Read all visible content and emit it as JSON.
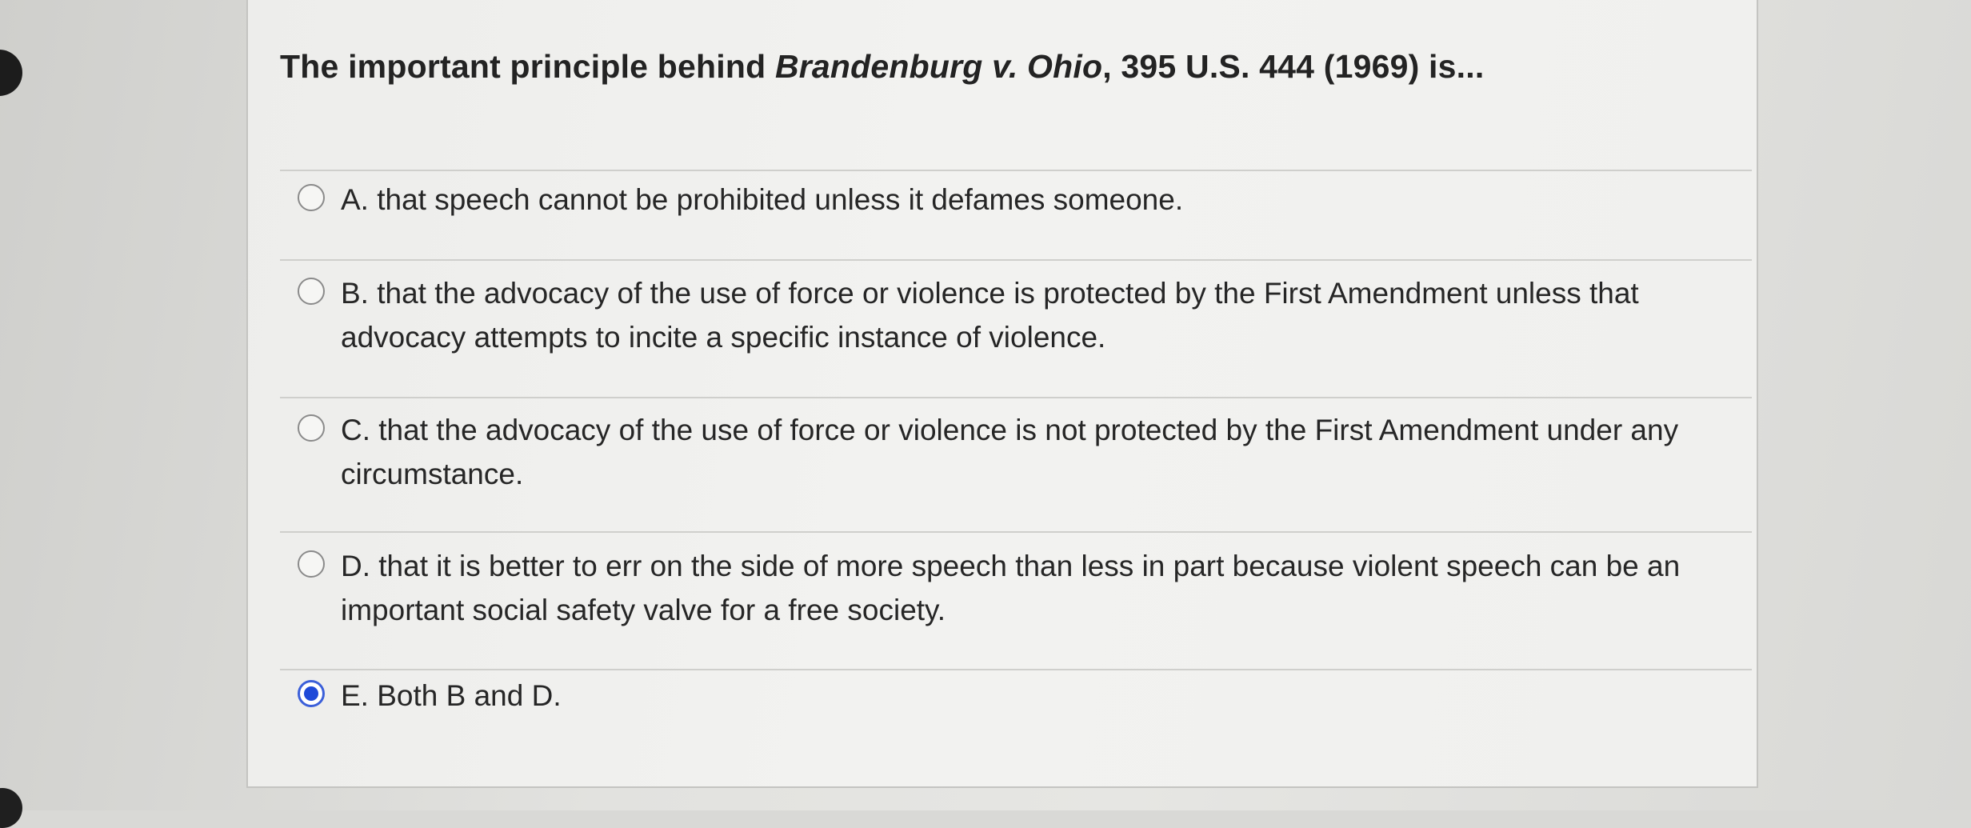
{
  "question": {
    "prefix": "The important principle behind ",
    "case_name": "Brandenburg v. Ohio",
    "suffix": ", 395 U.S. 444 (1969) is..."
  },
  "options": [
    {
      "label": "A. that speech cannot be prohibited unless it defames someone.",
      "selected": false
    },
    {
      "label": "B. that the advocacy of the use of force or violence is protected by the First Amendment unless that advocacy attempts to incite a specific instance of violence.",
      "selected": false
    },
    {
      "label": "C. that the advocacy of the use of force or violence is not protected by the First Amendment under any circumstance.",
      "selected": false
    },
    {
      "label": "D. that it is better to err on the side of more speech than less in part because violent speech can be an important social safety valve for a free society.",
      "selected": false
    },
    {
      "label": "E. Both B and D.",
      "selected": true
    }
  ],
  "colors": {
    "selected_radio": "#1e49d8",
    "text": "#262626"
  }
}
